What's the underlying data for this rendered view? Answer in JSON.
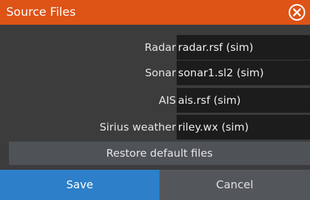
{
  "dialog": {
    "title": "Source Files",
    "close_icon": "close-circle-icon"
  },
  "rows": [
    {
      "label": "Radar",
      "value": "radar.rsf (sim)"
    },
    {
      "label": "Sonar",
      "value": "sonar1.sl2 (sim)"
    },
    {
      "label": "AIS",
      "value": "ais.rsf (sim)"
    },
    {
      "label": "Sirius weather",
      "value": "riley.wx (sim)"
    }
  ],
  "actions": {
    "restore_label": "Restore default files",
    "save_label": "Save",
    "cancel_label": "Cancel"
  },
  "colors": {
    "titlebar": "#de5316",
    "background": "#3c3c3c",
    "field": "#1c1c1c",
    "save": "#2c7fc8",
    "cancel": "#53575c",
    "restore": "#4f5358"
  }
}
